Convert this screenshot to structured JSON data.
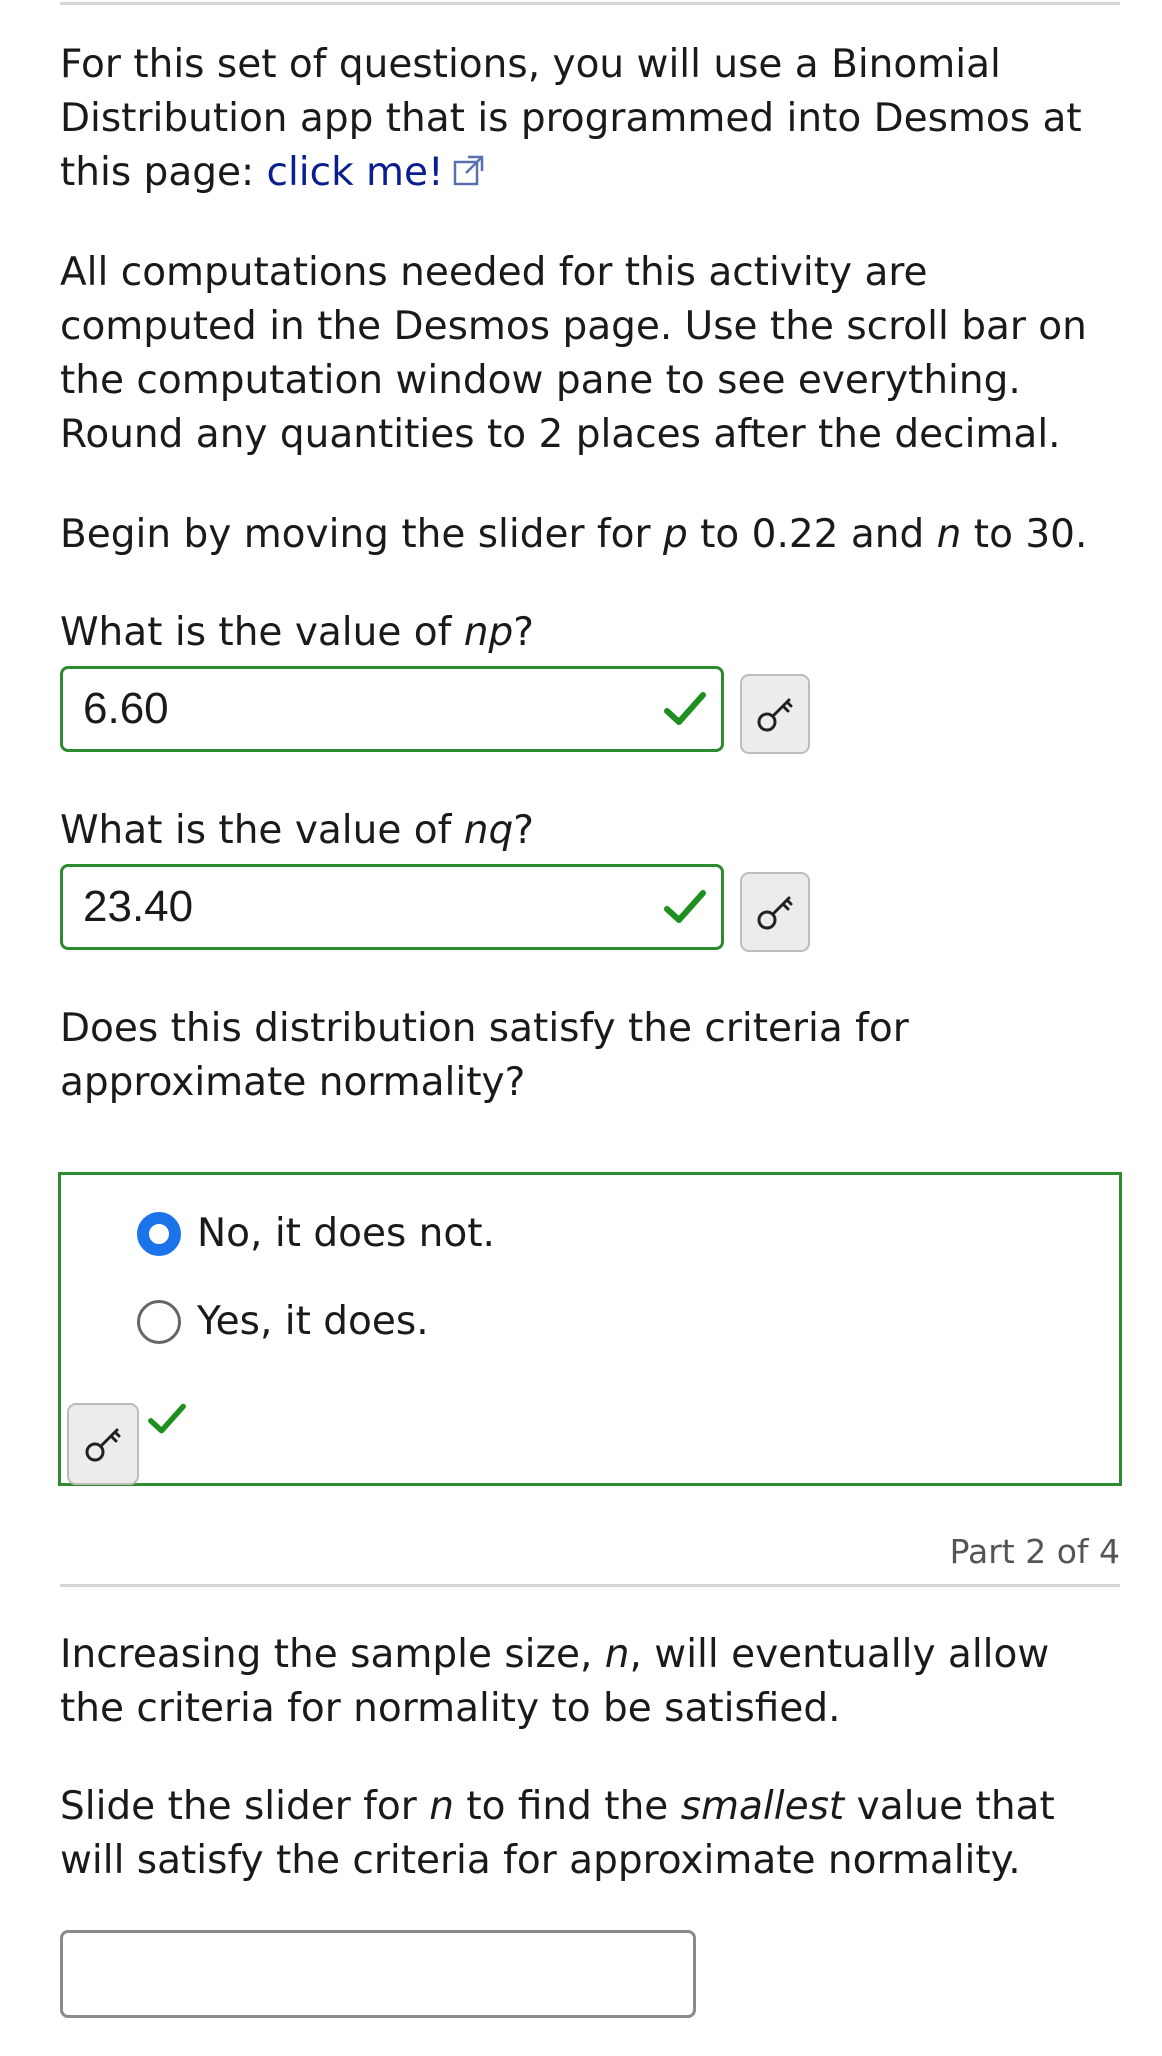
{
  "intro": {
    "line_start": "For this set of questions, you will use a Binomial Distribution app that is programmed into Desmos at this page:",
    "link_text": "click me!",
    "link_icon": "external-link-icon"
  },
  "instructions": "All computations needed for this activity are computed in the Desmos page. Use the scroll bar on the computation window pane to see everything. Round any quantities to 2 places after the decimal.",
  "slider_instruction": {
    "a": "Begin by moving the slider for",
    "p": "p",
    "b": "to 0.22 and",
    "n": "n",
    "c": "to 30."
  },
  "q1": {
    "prefix": "What is the value of",
    "var": "np",
    "suffix": "?",
    "answer": "6.60"
  },
  "q2": {
    "prefix": "What is the value of",
    "var": "nq",
    "suffix": "?",
    "answer": "23.40"
  },
  "q3": {
    "question": "Does this distribution satisfy the criteria for approximate normality?",
    "options": [
      "No, it does not.",
      "Yes, it does."
    ],
    "selected": 0
  },
  "part_label": "Part 2 of 4",
  "part2": {
    "p1_a": "Increasing the sample size,",
    "p1_n": "n",
    "p1_b": ", will eventually allow the criteria for normality to be satisfied.",
    "p2_a": "Slide the slider for",
    "p2_n": "n",
    "p2_b": "to find the",
    "p2_em": "smallest",
    "p2_c": "value that will satisfy the criteria for approximate normality.",
    "answer": ""
  },
  "colors": {
    "correct": "#2e8b2e",
    "link": "#0a1f8f",
    "radio": "#1a73e8",
    "check": "#1f8f1f"
  }
}
